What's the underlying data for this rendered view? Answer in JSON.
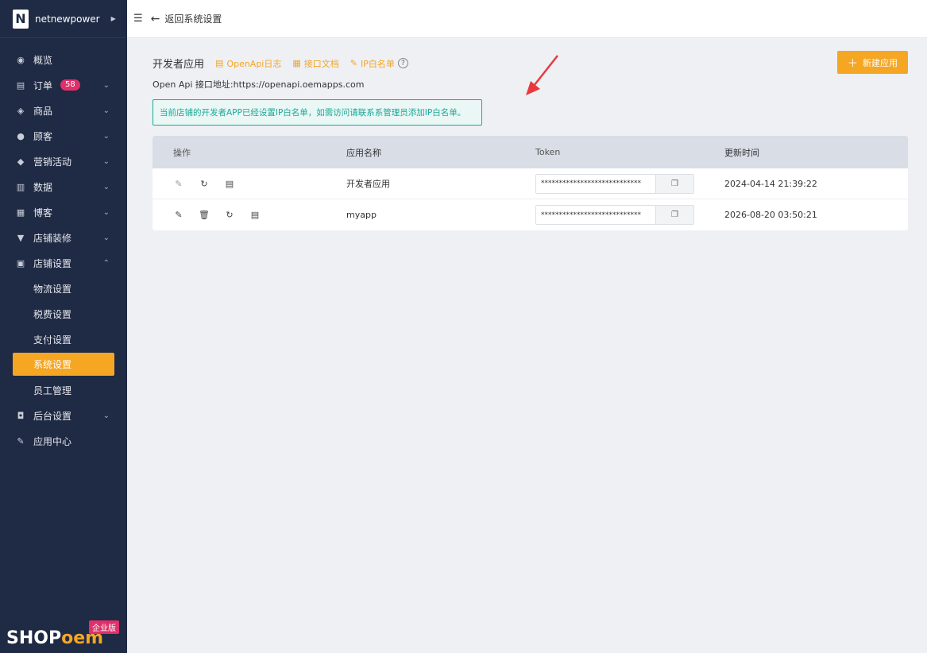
{
  "brand": {
    "letter": "N",
    "name": "netnewpower"
  },
  "sidebar": {
    "items": [
      {
        "label": "概览",
        "icon": "dashboard-icon"
      },
      {
        "label": "订单",
        "icon": "order-icon",
        "badge": "58"
      },
      {
        "label": "商品",
        "icon": "product-icon"
      },
      {
        "label": "顾客",
        "icon": "customer-icon"
      },
      {
        "label": "营销活动",
        "icon": "tag-icon"
      },
      {
        "label": "数据",
        "icon": "chart-icon"
      },
      {
        "label": "博客",
        "icon": "blog-icon"
      },
      {
        "label": "店铺装修",
        "icon": "paint-icon"
      },
      {
        "label": "店铺设置",
        "icon": "store-icon"
      }
    ],
    "sub_items": [
      "物流设置",
      "税费设置",
      "支付设置",
      "系统设置",
      "员工管理"
    ],
    "after_items": [
      {
        "label": "后台设置",
        "icon": "admin-icon"
      },
      {
        "label": "应用中心",
        "icon": "wrench-icon"
      }
    ],
    "logo_text_a": "SHOP",
    "logo_text_b": "oem",
    "edition_badge": "企业版"
  },
  "header": {
    "back_label": "返回系统设置"
  },
  "main": {
    "title": "开发者应用",
    "link_log": "OpenApi日志",
    "link_docs": "接口文档",
    "link_ip": "IP白名单",
    "help": "?",
    "new_button": "新建应用",
    "api_url": "Open Api 接口地址:https://openapi.oemapps.com",
    "notice": "当前店铺的开发者APP已经设置IP白名单，如需访问请联系系管理员添加IP白名单。"
  },
  "table": {
    "headers": {
      "op": "操作",
      "name": "应用名称",
      "token": "Token",
      "time": "更新时间"
    },
    "rows": [
      {
        "name": "开发者应用",
        "token": "****************************",
        "time": "2024-04-14 21:39:22"
      },
      {
        "name": "myapp",
        "token": "****************************",
        "time": "2026-08-20 03:50:21"
      }
    ]
  },
  "colors": {
    "accent": "#f5a623",
    "sidebar": "#1f2a44",
    "notice": "#1aa898",
    "badge": "#e0306b",
    "pointer_arrow": "#e8393f"
  }
}
